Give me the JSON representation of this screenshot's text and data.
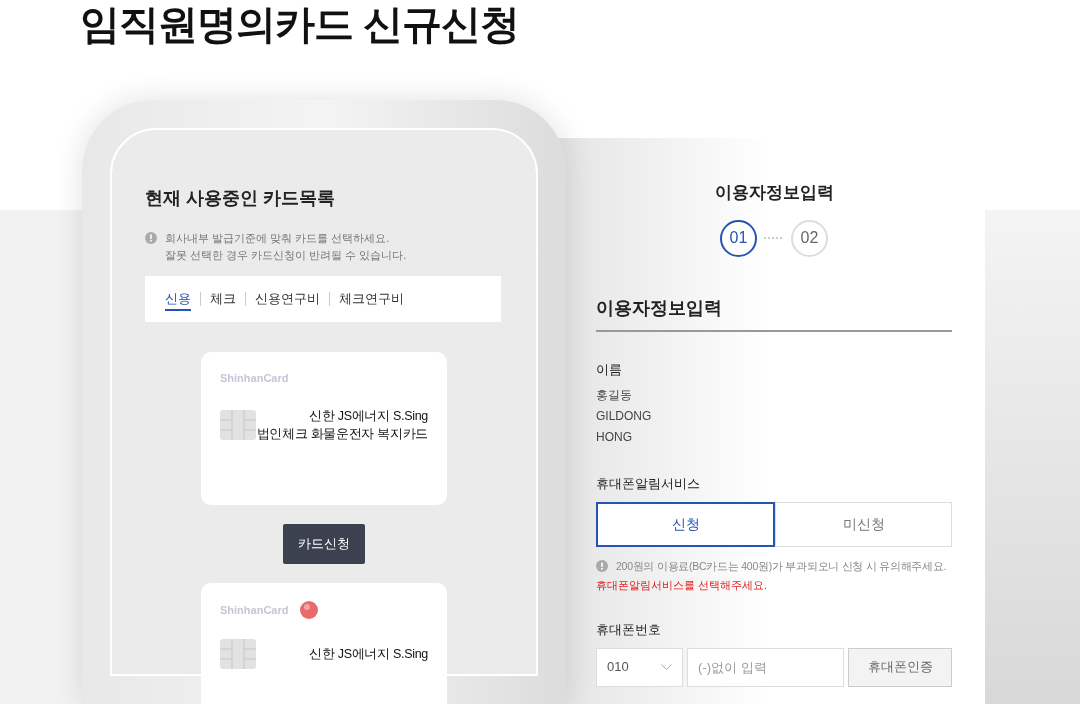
{
  "page_title": "임직원명의카드 신규신청",
  "phone": {
    "section_title": "현재 사용중인 카드목록",
    "notice_lines": [
      "회사내부 발급기준에 맞춰 카드를 선택하세요.",
      "잘못 선택한 경우 카드신청이 반려될 수 있습니다."
    ],
    "tabs": [
      {
        "label": "신용",
        "selected": true
      },
      {
        "label": "체크",
        "selected": false
      },
      {
        "label": "신용연구비",
        "selected": false
      },
      {
        "label": "체크연구비",
        "selected": false
      }
    ],
    "cards": [
      {
        "brand": "ShinhanCard",
        "bc_logo": false,
        "name_lines": [
          "신한 JS에너지 S.Sing",
          "법인체크 화물운전자 복지카드"
        ]
      },
      {
        "brand": "ShinhanCard",
        "bc_logo": true,
        "name_lines": [
          "신한 JS에너지 S.Sing"
        ]
      }
    ],
    "apply_button": "카드신청"
  },
  "form": {
    "step_title": "이용자정보입력",
    "steps": [
      {
        "label": "01",
        "selected": true
      },
      {
        "label": "02",
        "selected": false
      }
    ],
    "section_title": "이용자정보입력",
    "name": {
      "label": "이름",
      "values": [
        "홍길동",
        "GILDONG",
        "HONG"
      ]
    },
    "alert_service": {
      "label": "휴대폰알림서비스",
      "options": [
        {
          "label": "신청",
          "selected": true
        },
        {
          "label": "미신청",
          "selected": false
        }
      ],
      "notice": "200원의 이용료(BC카드는 400원)가 부과되오니 신청 시 유의해주세요.",
      "error": "휴대폰알림서비스를 선택해주세요."
    },
    "phone_number": {
      "label": "휴대폰번호",
      "prefix": "010",
      "placeholder": "(-)없이 입력",
      "verify_button": "휴대폰인증"
    }
  }
}
